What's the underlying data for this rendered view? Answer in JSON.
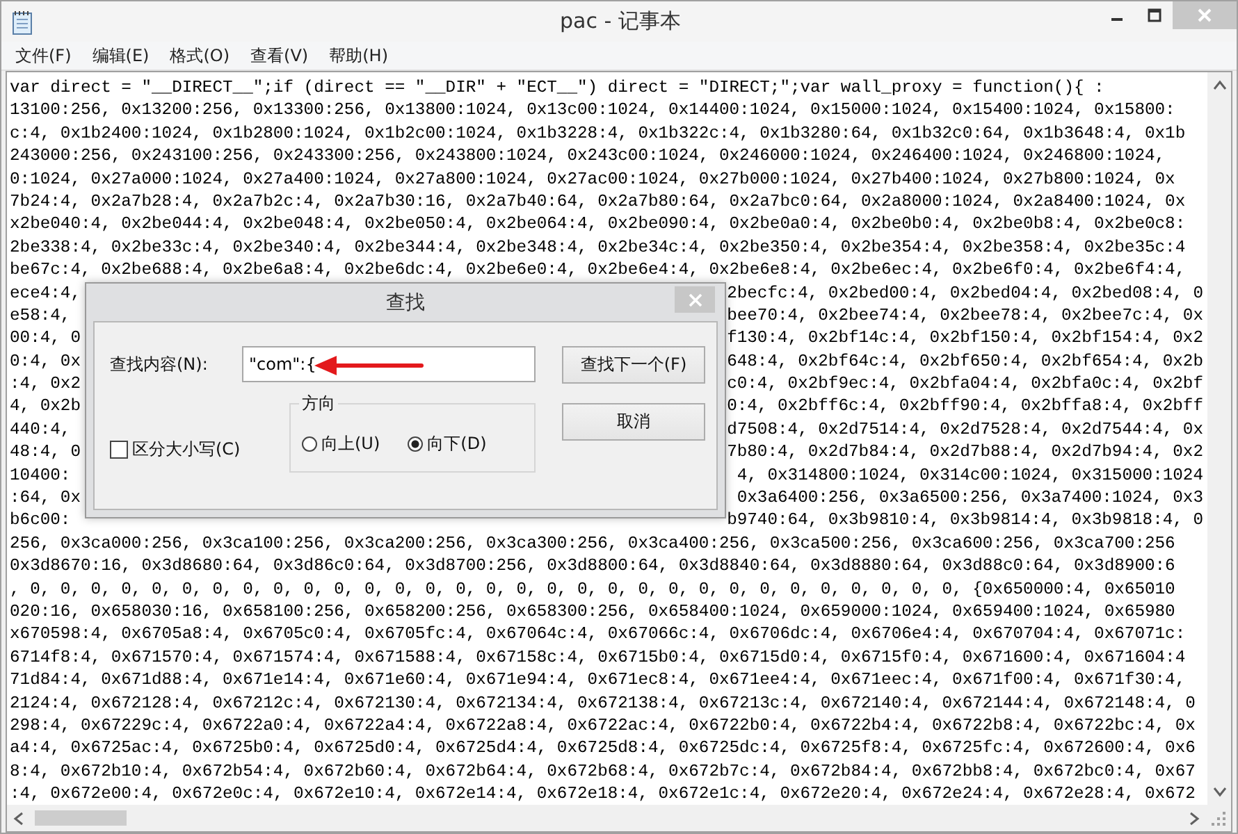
{
  "window": {
    "title": "pac - 记事本"
  },
  "menu": [
    {
      "label": "文件(F)"
    },
    {
      "label": "编辑(E)"
    },
    {
      "label": "格式(O)"
    },
    {
      "label": "查看(V)"
    },
    {
      "label": "帮助(H)"
    }
  ],
  "editor": {
    "lines": [
      {
        "kind": "full",
        "text": "var direct = \"__DIRECT__\";if (direct == \"__DIR\" + \"ECT__\") direct = \"DIRECT;\";var wall_proxy = function(){ :"
      },
      {
        "kind": "full",
        "text": "13100:256, 0x13200:256, 0x13300:256, 0x13800:1024, 0x13c00:1024, 0x14400:1024, 0x15000:1024, 0x15400:1024, 0x15800:"
      },
      {
        "kind": "full",
        "text": "c:4, 0x1b2400:1024, 0x1b2800:1024, 0x1b2c00:1024, 0x1b3228:4, 0x1b322c:4, 0x1b3280:64, 0x1b32c0:64, 0x1b3648:4, 0x1b"
      },
      {
        "kind": "full",
        "text": "243000:256, 0x243100:256, 0x243300:256, 0x243800:1024, 0x243c00:1024, 0x246000:1024, 0x246400:1024, 0x246800:1024,"
      },
      {
        "kind": "full",
        "text": "0:1024, 0x27a000:1024, 0x27a400:1024, 0x27a800:1024, 0x27ac00:1024, 0x27b000:1024, 0x27b400:1024, 0x27b800:1024, 0x"
      },
      {
        "kind": "full",
        "text": "7b24:4, 0x2a7b28:4, 0x2a7b2c:4, 0x2a7b30:16, 0x2a7b40:64, 0x2a7b80:64, 0x2a7bc0:64, 0x2a8000:1024, 0x2a8400:1024, 0x"
      },
      {
        "kind": "full",
        "text": "x2be040:4, 0x2be044:4, 0x2be048:4, 0x2be050:4, 0x2be064:4, 0x2be090:4, 0x2be0a0:4, 0x2be0b0:4, 0x2be0b8:4, 0x2be0c8:"
      },
      {
        "kind": "full",
        "text": "2be338:4, 0x2be33c:4, 0x2be340:4, 0x2be344:4, 0x2be348:4, 0x2be34c:4, 0x2be350:4, 0x2be354:4, 0x2be358:4, 0x2be35c:4"
      },
      {
        "kind": "full",
        "text": "be67c:4, 0x2be688:4, 0x2be6a8:4, 0x2be6dc:4, 0x2be6e0:4, 0x2be6e4:4, 0x2be6e8:4, 0x2be6ec:4, 0x2be6f0:4, 0x2be6f4:4,"
      },
      {
        "kind": "split",
        "left": "ece4:4,",
        "right": "2becfc:4, 0x2bed00:4, 0x2bed04:4, 0x2bed08:4, 0"
      },
      {
        "kind": "split",
        "left": "e58:4,",
        "right": "bee70:4, 0x2bee74:4, 0x2bee78:4, 0x2bee7c:4, 0x"
      },
      {
        "kind": "split",
        "left": "00:4, 0",
        "right": "f130:4, 0x2bf14c:4, 0x2bf150:4, 0x2bf154:4, 0x2"
      },
      {
        "kind": "split",
        "left": "0:4, 0x",
        "right": "648:4, 0x2bf64c:4, 0x2bf650:4, 0x2bf654:4, 0x2b"
      },
      {
        "kind": "split",
        "left": ":4, 0x2",
        "right": "c0:4, 0x2bf9ec:4, 0x2bfa04:4, 0x2bfa0c:4, 0x2bf"
      },
      {
        "kind": "split",
        "left": "4, 0x2b",
        "right": "0:4, 0x2bff6c:4, 0x2bff90:4, 0x2bffa8:4, 0x2bff"
      },
      {
        "kind": "split",
        "left": "440:4,",
        "right": "d7508:4, 0x2d7514:4, 0x2d7528:4, 0x2d7544:4, 0x"
      },
      {
        "kind": "split",
        "left": "48:4, 0",
        "right": "7b80:4, 0x2d7b84:4, 0x2d7b88:4, 0x2d7b94:4, 0x2"
      },
      {
        "kind": "split",
        "left": "10400:",
        "right": "4, 0x314800:1024, 0x314c00:1024, 0x315000:1024"
      },
      {
        "kind": "split",
        "left": ":64, 0x",
        "right": "0x3a6400:256, 0x3a6500:256, 0x3a7400:1024, 0x3"
      },
      {
        "kind": "split",
        "left": "b6c00:",
        "right": "b9740:64, 0x3b9810:4, 0x3b9814:4, 0x3b9818:4, 0"
      },
      {
        "kind": "full",
        "text": "256, 0x3ca000:256, 0x3ca100:256, 0x3ca200:256, 0x3ca300:256, 0x3ca400:256, 0x3ca500:256, 0x3ca600:256, 0x3ca700:256"
      },
      {
        "kind": "full",
        "text": "0x3d8670:16, 0x3d8680:64, 0x3d86c0:64, 0x3d8700:256, 0x3d8800:64, 0x3d8840:64, 0x3d8880:64, 0x3d88c0:64, 0x3d8900:6"
      },
      {
        "kind": "full",
        "text": ", 0, 0, 0, 0, 0, 0, 0, 0, 0, 0, 0, 0, 0, 0, 0, 0, 0, 0, 0, 0, 0, 0, 0, 0, 0, 0, 0, 0, 0, 0, 0, {0x650000:4, 0x65010"
      },
      {
        "kind": "full",
        "text": "020:16, 0x658030:16, 0x658100:256, 0x658200:256, 0x658300:256, 0x658400:1024, 0x659000:1024, 0x659400:1024, 0x65980"
      },
      {
        "kind": "full",
        "text": "x670598:4, 0x6705a8:4, 0x6705c0:4, 0x6705fc:4, 0x67064c:4, 0x67066c:4, 0x6706dc:4, 0x6706e4:4, 0x670704:4, 0x67071c:"
      },
      {
        "kind": "full",
        "text": "6714f8:4, 0x671570:4, 0x671574:4, 0x671588:4, 0x67158c:4, 0x6715b0:4, 0x6715d0:4, 0x6715f0:4, 0x671600:4, 0x671604:4"
      },
      {
        "kind": "full",
        "text": "71d84:4, 0x671d88:4, 0x671e14:4, 0x671e60:4, 0x671e94:4, 0x671ec8:4, 0x671ee4:4, 0x671eec:4, 0x671f00:4, 0x671f30:4,"
      },
      {
        "kind": "full",
        "text": "2124:4, 0x672128:4, 0x67212c:4, 0x672130:4, 0x672134:4, 0x672138:4, 0x67213c:4, 0x672140:4, 0x672144:4, 0x672148:4, 0"
      },
      {
        "kind": "full",
        "text": "298:4, 0x67229c:4, 0x6722a0:4, 0x6722a4:4, 0x6722a8:4, 0x6722ac:4, 0x6722b0:4, 0x6722b4:4, 0x6722b8:4, 0x6722bc:4, 0x"
      },
      {
        "kind": "full",
        "text": "a4:4, 0x6725ac:4, 0x6725b0:4, 0x6725d0:4, 0x6725d4:4, 0x6725d8:4, 0x6725dc:4, 0x6725f8:4, 0x6725fc:4, 0x672600:4, 0x6"
      },
      {
        "kind": "full",
        "text": "8:4, 0x672b10:4, 0x672b54:4, 0x672b60:4, 0x672b64:4, 0x672b68:4, 0x672b7c:4, 0x672b84:4, 0x672bb8:4, 0x672bc0:4, 0x67"
      },
      {
        "kind": "full",
        "text": ":4, 0x672e00:4, 0x672e0c:4, 0x672e10:4, 0x672e14:4, 0x672e18:4, 0x672e1c:4, 0x672e20:4, 0x672e24:4, 0x672e28:4, 0x672"
      }
    ]
  },
  "find_dialog": {
    "title": "查找",
    "find_label": "查找内容(N):",
    "find_value": "\"com\":{",
    "find_next_button": "查找下一个(F)",
    "cancel_button": "取消",
    "direction": {
      "label": "方向",
      "options": [
        {
          "label": "向上(U)",
          "selected": false
        },
        {
          "label": "向下(D)",
          "selected": true
        }
      ]
    },
    "match_case": {
      "label": "区分大小写(C)",
      "checked": false
    }
  }
}
